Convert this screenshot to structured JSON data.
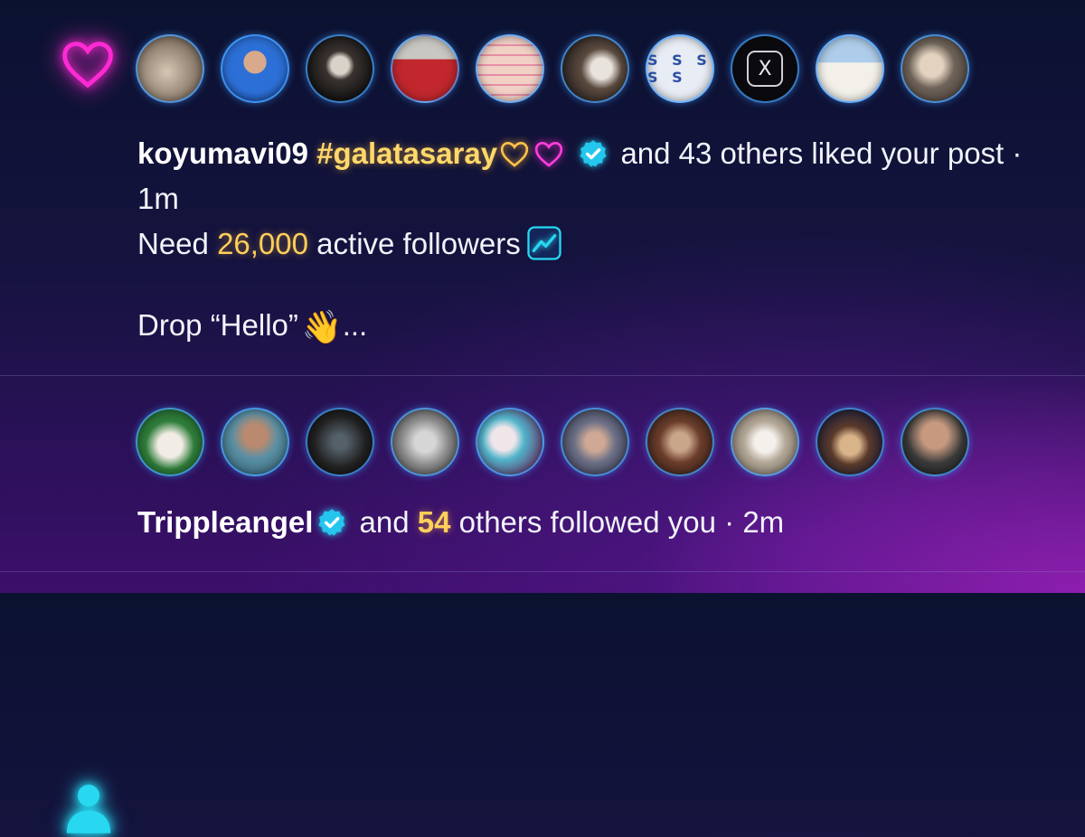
{
  "likes_notification": {
    "type_icon": "heart-icon",
    "username": "koyumavi09",
    "hashtag": "#galatasaray",
    "rest_text": " and 43 others liked your post · 1m",
    "line2_prefix": "Need ",
    "line2_number": "26,000",
    "line2_suffix": " active followers",
    "line3_text": "Drop “Hello”",
    "line3_wave": "👋",
    "line3_suffix": "...",
    "x_logo_letter": "X",
    "avatar_s_text": "S S S S S",
    "colors": {
      "heart": "#ff2ad4",
      "hashtag": "#ffd86b",
      "badge": "#25c6ee"
    }
  },
  "follows_notification": {
    "type_icon": "user-icon",
    "username": "Trippleangel",
    "text_mid": " and ",
    "count": "54",
    "text_end": " others followed you · 2m",
    "colors": {
      "icon": "#27d8f0",
      "count": "#ffcf5a"
    }
  }
}
